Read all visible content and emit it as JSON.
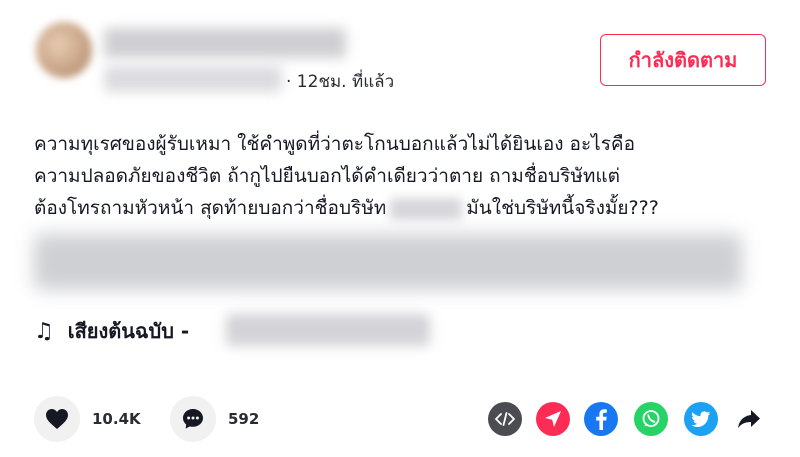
{
  "post": {
    "time_ago": "· 12ชม. ที่แล้ว",
    "follow_label": "กำลังติดตาม",
    "caption_lines": [
      "ความทุเรศของผู้รับเหมา ใช้คำพูดที่ว่าตะโกนบอกแล้วไม่ได้ยินเอง อะไรคือ",
      "ความปลอดภัยของชีวิต ถ้ากูไปยืนบอกได้คำเดียวว่าตาย ถามชื่อบริษัทแต่",
      "ต้องโทรถามหัวหน้า สุดท้ายบอกว่าชื่อบริษัท",
      "มันใช่บริษัทนี้จริงมั้ย???"
    ],
    "music_label": "เสียงต้นฉบับ -",
    "likes": "10.4K",
    "comments": "592"
  },
  "share_icons": [
    "embed-icon",
    "send-icon",
    "facebook-icon",
    "whatsapp-icon",
    "twitter-icon",
    "share-arrow-icon"
  ],
  "colors": {
    "accent": "#fe2c55",
    "embed": "#4b4b52",
    "send": "#fe2c55",
    "facebook": "#1877f2",
    "whatsapp": "#25d366",
    "twitter": "#1da1f2"
  }
}
